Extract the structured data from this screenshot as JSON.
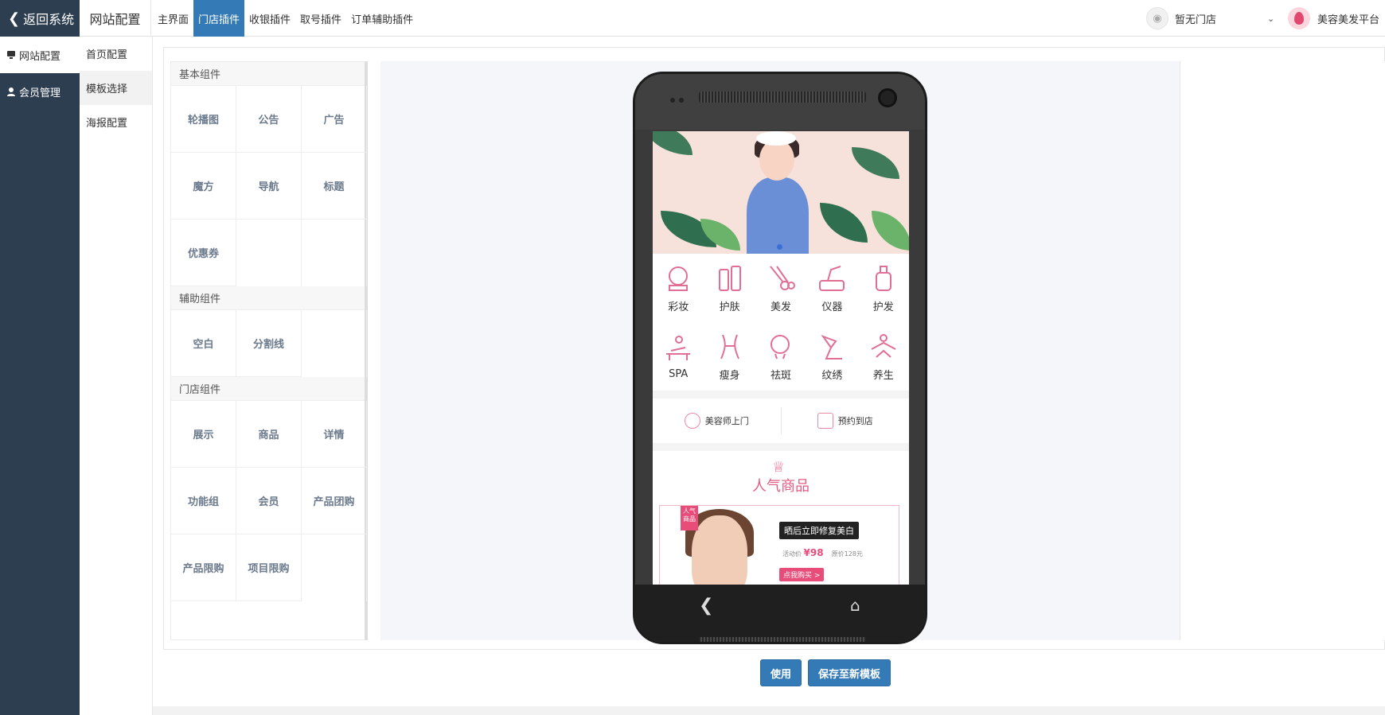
{
  "topbar": {
    "back_label": "返回系统",
    "brand": "网站配置",
    "tabs": [
      "主界面",
      "门店插件",
      "收银插件",
      "取号插件",
      "订单辅助插件"
    ],
    "active_tab": 1,
    "store_label": "暂无门店",
    "platform_name": "美容美发平台"
  },
  "sidebar": {
    "items": [
      {
        "label": "网站配置",
        "icon": "monitor-icon"
      },
      {
        "label": "会员管理",
        "icon": "user-icon"
      }
    ]
  },
  "subnav": {
    "items": [
      "首页配置",
      "模板选择",
      "海报配置"
    ]
  },
  "components": {
    "groups": [
      {
        "title": "基本组件",
        "items": [
          "轮播图",
          "公告",
          "广告",
          "魔方",
          "导航",
          "标题",
          "优惠券"
        ]
      },
      {
        "title": "辅助组件",
        "items": [
          "空白",
          "分割线"
        ]
      },
      {
        "title": "门店组件",
        "items": [
          "展示",
          "商品",
          "详情",
          "功能组",
          "会员",
          "产品团购",
          "产品限购",
          "项目限购"
        ]
      }
    ]
  },
  "phone": {
    "icons": [
      {
        "label": "彩妆",
        "icon": "makeup-icon"
      },
      {
        "label": "护肤",
        "icon": "skincare-icon"
      },
      {
        "label": "美发",
        "icon": "hair-scissors-icon"
      },
      {
        "label": "仪器",
        "icon": "instrument-icon"
      },
      {
        "label": "护发",
        "icon": "haircare-icon"
      },
      {
        "label": "SPA",
        "icon": "spa-icon"
      },
      {
        "label": "瘦身",
        "icon": "slimming-icon"
      },
      {
        "label": "祛斑",
        "icon": "freckle-icon"
      },
      {
        "label": "纹绣",
        "icon": "tattoo-icon"
      },
      {
        "label": "养生",
        "icon": "wellness-icon"
      }
    ],
    "services": [
      "美容师上门",
      "预约到店"
    ],
    "popular_title": "人气商品",
    "product": {
      "ribbon": "人气商品",
      "promo": "晒后立即修复美白",
      "act_label": "活动价",
      "act_price": "¥98",
      "orig_price": "原价128元",
      "buy_label": "点我购买 >"
    }
  },
  "actions": {
    "use_label": "使用",
    "save_label": "保存至新模板"
  },
  "colors": {
    "primary": "#337ab7",
    "sidebar": "#2d3e50",
    "accent_pink": "#e84d7a"
  }
}
